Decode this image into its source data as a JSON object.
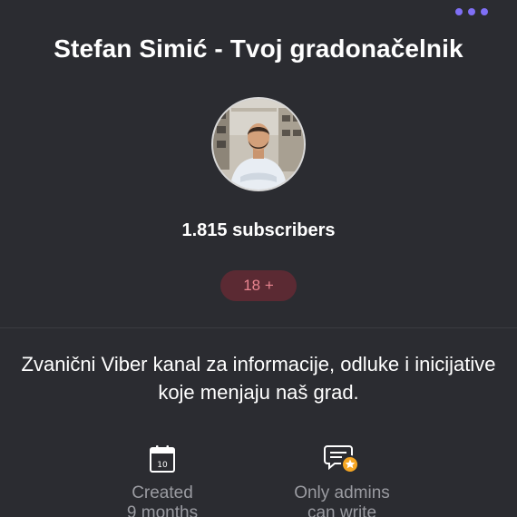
{
  "header": {
    "title": "Stefan Simić - Tvoj gradonačelnik",
    "more_icon": "more-dots-icon",
    "accent_color": "#7f6ff5"
  },
  "profile": {
    "avatar_icon": "channel-avatar-photo",
    "subscribers": "1.815 subscribers",
    "age_badge": "18 +"
  },
  "about": {
    "description": "Zvanični Viber kanal za informacije, odluke i inicijative koje menjaju naš grad."
  },
  "info": {
    "created": {
      "icon": "calendar-icon",
      "calendar_day": "10",
      "line1": "Created",
      "line2": "9 months"
    },
    "admins": {
      "icon": "admin-chat-icon",
      "line1": "Only admins",
      "line2": "can write"
    }
  }
}
